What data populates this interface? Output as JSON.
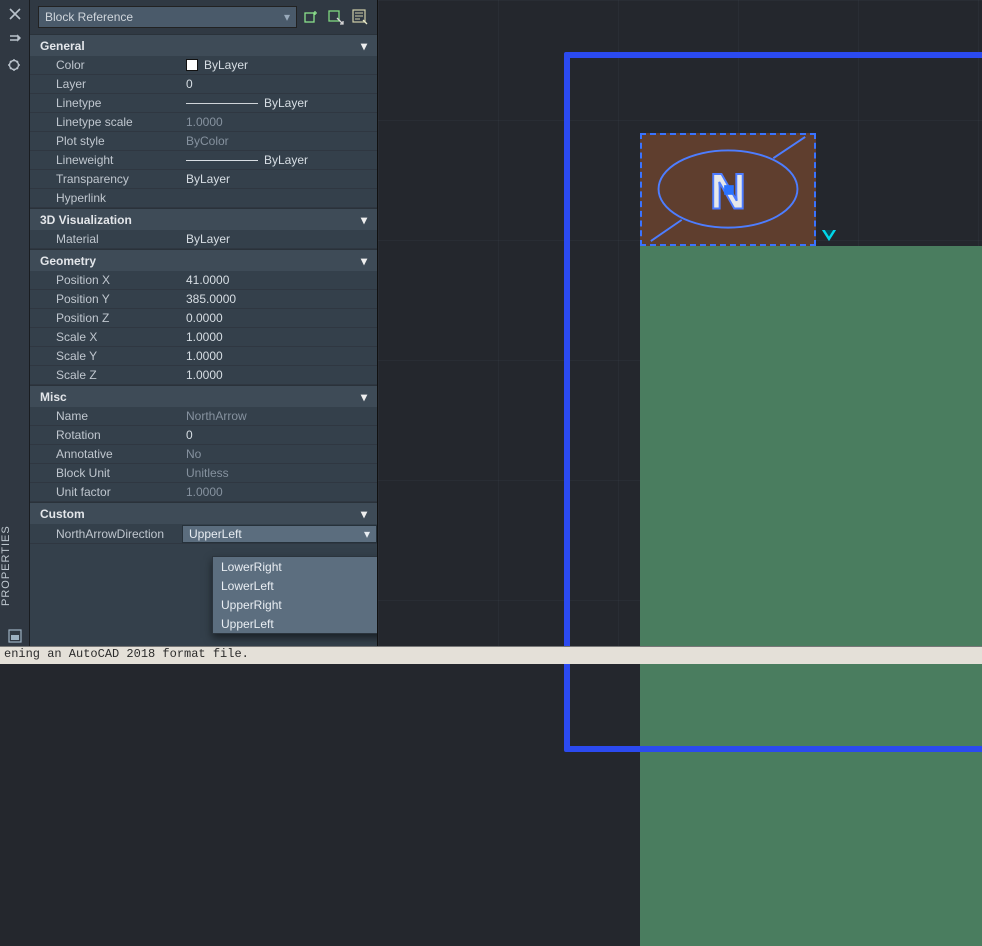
{
  "palette_label": "PROPERTIES",
  "object_type": "Block Reference",
  "sections": {
    "general": {
      "title": "General",
      "color_label": "Color",
      "color_value": "ByLayer",
      "layer_label": "Layer",
      "layer_value": "0",
      "linetype_label": "Linetype",
      "linetype_value": "ByLayer",
      "ltscale_label": "Linetype scale",
      "ltscale_value": "1.0000",
      "plotstyle_label": "Plot style",
      "plotstyle_value": "ByColor",
      "lineweight_label": "Lineweight",
      "lineweight_value": "ByLayer",
      "transparency_label": "Transparency",
      "transparency_value": "ByLayer",
      "hyperlink_label": "Hyperlink",
      "hyperlink_value": ""
    },
    "viz": {
      "title": "3D Visualization",
      "material_label": "Material",
      "material_value": "ByLayer"
    },
    "geometry": {
      "title": "Geometry",
      "posx_label": "Position X",
      "posx_value": "41.0000",
      "posy_label": "Position Y",
      "posy_value": "385.0000",
      "posz_label": "Position Z",
      "posz_value": "0.0000",
      "scalex_label": "Scale X",
      "scalex_value": "1.0000",
      "scaley_label": "Scale Y",
      "scaley_value": "1.0000",
      "scalez_label": "Scale Z",
      "scalez_value": "1.0000"
    },
    "misc": {
      "title": "Misc",
      "name_label": "Name",
      "name_value": "NorthArrow",
      "rotation_label": "Rotation",
      "rotation_value": "0",
      "annotative_label": "Annotative",
      "annotative_value": "No",
      "blockunit_label": "Block Unit",
      "blockunit_value": "Unitless",
      "unitfactor_label": "Unit factor",
      "unitfactor_value": "1.0000"
    },
    "custom": {
      "title": "Custom",
      "naprop_label": "NorthArrowDirection",
      "naprop_value": "UpperLeft",
      "options": [
        "LowerRight",
        "LowerLeft",
        "UpperRight",
        "UpperLeft"
      ]
    }
  },
  "cmdline": "ening an AutoCAD 2018 format file."
}
